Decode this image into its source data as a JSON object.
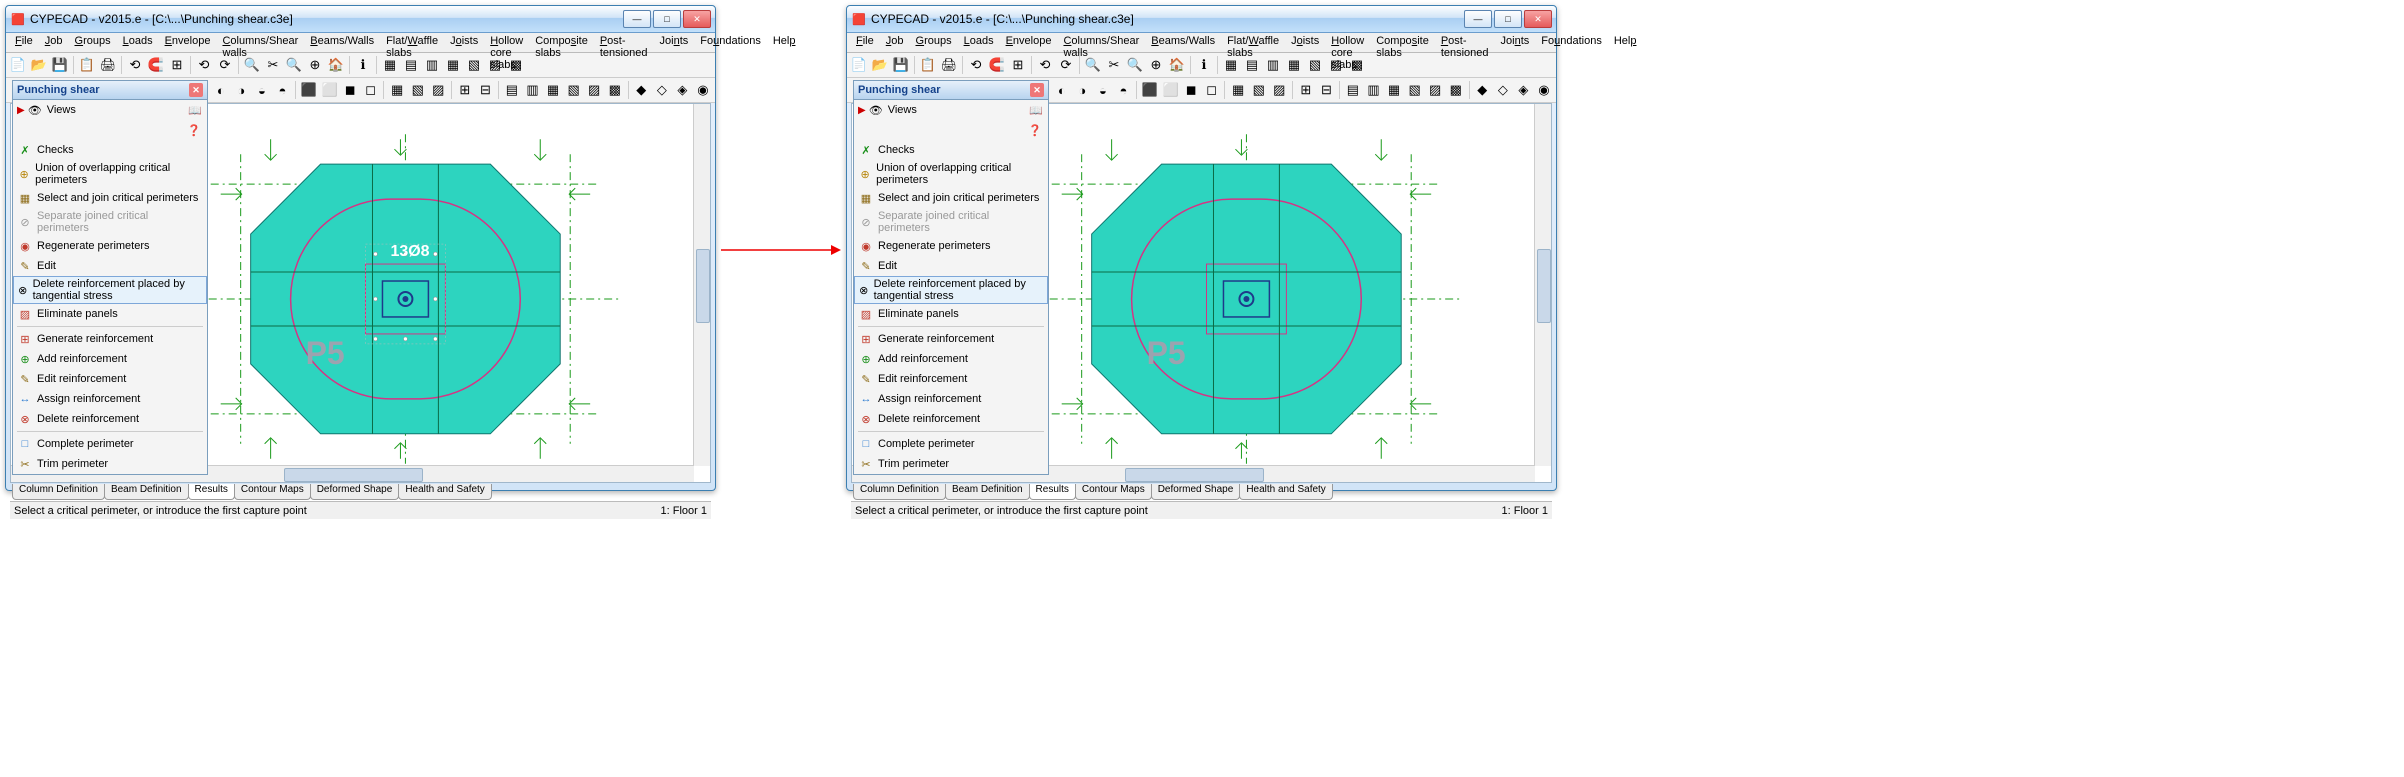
{
  "title_full": "CYPECAD - v2015.e - [C:\\...\\Punching shear.c3e]",
  "menu": [
    "File",
    "Job",
    "Groups",
    "Loads",
    "Envelope",
    "Columns/Shear walls",
    "Beams/Walls",
    "Flat/Waffle slabs",
    "Joists",
    "Hollow core slabs",
    "Composite slabs",
    "Post-tensioned",
    "Joints",
    "Foundations",
    "Help"
  ],
  "menu_uline": [
    "F",
    "J",
    "G",
    "L",
    "E",
    "C",
    "B",
    "W",
    "o",
    "H",
    "s",
    "P",
    "n",
    "u",
    "p"
  ],
  "panel": {
    "title": "Punching shear",
    "views": "Views",
    "items": [
      {
        "icon": "✗",
        "label": "Checks",
        "color": "#1a8f1a"
      },
      {
        "icon": "⊕",
        "label": "Union of overlapping critical perimeters",
        "color": "#b8860b"
      },
      {
        "icon": "▦",
        "label": "Select and join critical perimeters",
        "color": "#8b6914"
      },
      {
        "icon": "⊘",
        "label": "Separate joined critical perimeters",
        "disabled": true,
        "color": "#999"
      },
      {
        "icon": "◉",
        "label": "Regenerate perimeters",
        "color": "#c0392b"
      },
      {
        "icon": "✎",
        "label": "Edit",
        "color": "#8b6914"
      }
    ],
    "selected": {
      "icon": "⊗",
      "label": "Delete reinforcement placed by tangential stress",
      "color": "#c0392b"
    },
    "items2": [
      {
        "icon": "▨",
        "label": "Eliminate panels",
        "color": "#c0392b"
      }
    ],
    "items3": [
      {
        "icon": "⊞",
        "label": "Generate reinforcement",
        "color": "#c0392b"
      },
      {
        "icon": "⊕",
        "label": "Add reinforcement",
        "color": "#1a8f1a"
      },
      {
        "icon": "✎",
        "label": "Edit reinforcement",
        "color": "#8b6914"
      },
      {
        "icon": "↔",
        "label": "Assign reinforcement",
        "color": "#2e7dd1"
      },
      {
        "icon": "⊗",
        "label": "Delete reinforcement",
        "color": "#c0392b"
      }
    ],
    "items4": [
      {
        "icon": "□",
        "label": "Complete perimeter",
        "color": "#2e7dd1"
      },
      {
        "icon": "✂",
        "label": "Trim perimeter",
        "color": "#8b6914"
      }
    ]
  },
  "tabs": [
    "Column Definition",
    "Beam Definition",
    "Results",
    "Contour Maps",
    "Deformed Shape",
    "Health and Safety"
  ],
  "active_tab": 2,
  "status_left": "Select a critical perimeter, or introduce the first capture point",
  "status_right": "1: Floor 1",
  "canvas": {
    "column_label": "P5",
    "rebar_text": "13Ø8"
  }
}
